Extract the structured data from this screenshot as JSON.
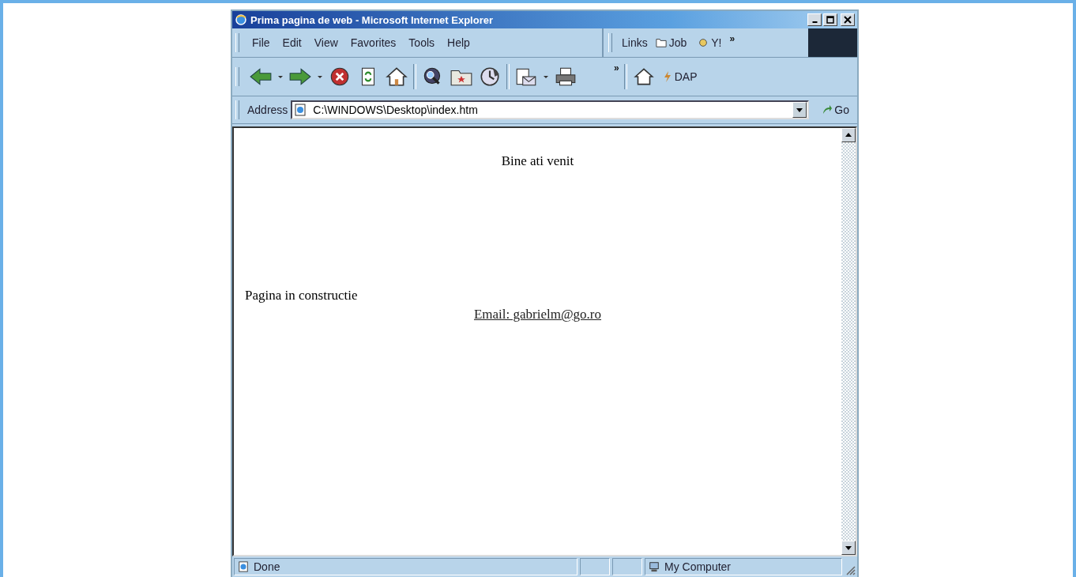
{
  "window": {
    "title": "Prima pagina de web - Microsoft Internet Explorer"
  },
  "menu": [
    {
      "label": "File"
    },
    {
      "label": "Edit"
    },
    {
      "label": "View"
    },
    {
      "label": "Favorites"
    },
    {
      "label": "Tools"
    },
    {
      "label": "Help"
    }
  ],
  "links_bar": {
    "label": "Links",
    "items": [
      {
        "kind": "folder",
        "label": "Job"
      },
      {
        "kind": "yahoo",
        "label": "Y!"
      }
    ],
    "more": "»"
  },
  "toolbar": {
    "buttons": [
      {
        "kind": "back"
      },
      {
        "kind": "dropdown"
      },
      {
        "kind": "forward"
      },
      {
        "kind": "dropdown"
      },
      {
        "kind": "stop"
      },
      {
        "kind": "refresh"
      },
      {
        "kind": "home"
      },
      {
        "kind": "sep"
      },
      {
        "kind": "search"
      },
      {
        "kind": "favorites"
      },
      {
        "kind": "history"
      },
      {
        "kind": "sep"
      },
      {
        "kind": "mail"
      },
      {
        "kind": "dropdown"
      },
      {
        "kind": "print"
      }
    ],
    "more": "»",
    "extra": {
      "label": "DAP"
    }
  },
  "address_bar": {
    "label": "Address",
    "url": "C:\\WINDOWS\\Desktop\\index.htm",
    "go": "Go"
  },
  "page": {
    "heading": "Bine ati venit",
    "text": "Pagina in constructie",
    "link": "Email: gabrielm@go.ro"
  },
  "status_bar": {
    "text": "Done",
    "zone": "My Computer"
  }
}
